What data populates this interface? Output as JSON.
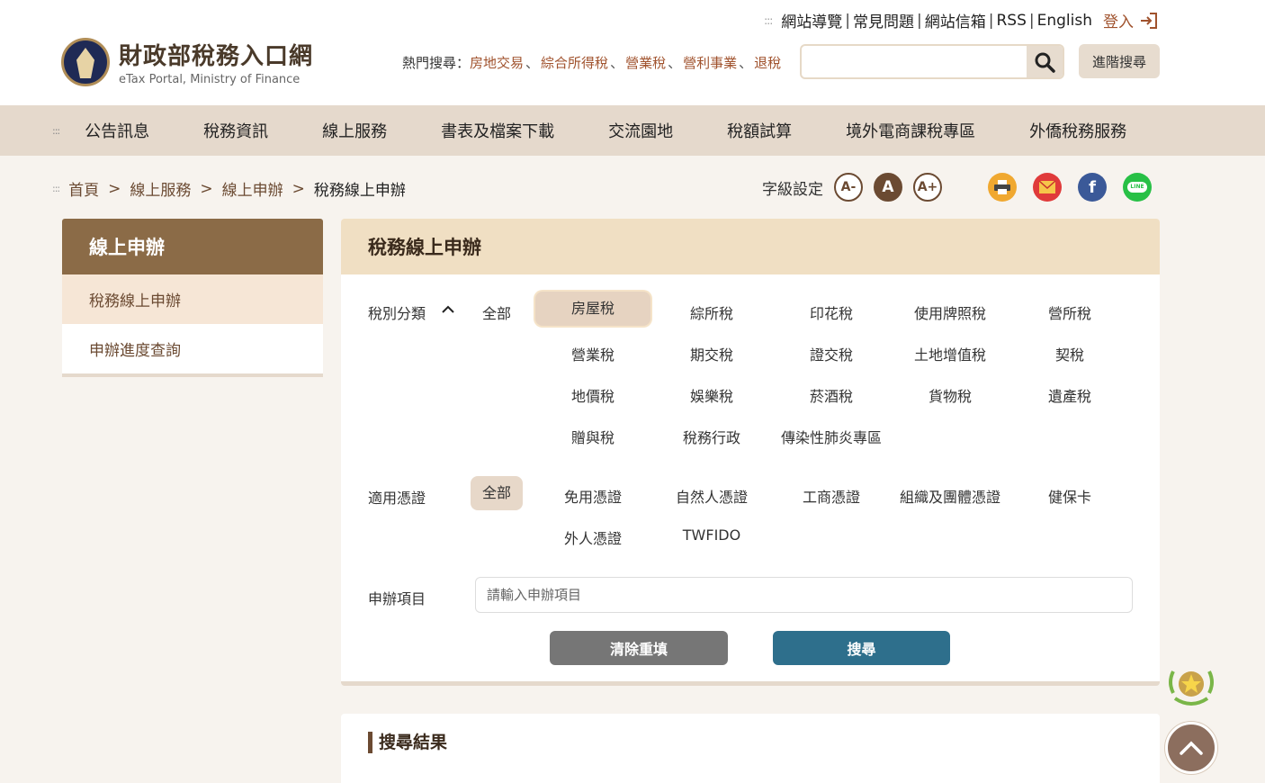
{
  "header": {
    "util_links": [
      "網站導覽",
      "常見問題",
      "網站信箱",
      "RSS",
      "English"
    ],
    "login_label": "登入",
    "logo_cn": "財政部稅務入口網",
    "logo_en": "eTax Portal, Ministry of Finance",
    "hot_label": "熱門搜尋：",
    "hot_keywords": [
      "房地交易",
      "綜合所得稅",
      "營業稅",
      "營利事業",
      "退稅"
    ],
    "search_placeholder": "",
    "advanced_search": "進階搜尋"
  },
  "mainnav": [
    "公告訊息",
    "稅務資訊",
    "線上服務",
    "書表及檔案下載",
    "交流園地",
    "稅額試算",
    "境外電商課稅專區",
    "外僑稅務服務"
  ],
  "breadcrumb": {
    "items": [
      "首頁",
      "線上服務",
      "線上申辦"
    ],
    "current": "稅務線上申辦"
  },
  "font_setting": {
    "label": "字級設定",
    "small": "A-",
    "medium": "A",
    "large": "A+"
  },
  "share": {
    "print_icon": "print-icon",
    "mail_icon": "mail-icon",
    "facebook_icon": "facebook-icon",
    "line_icon": "line-icon",
    "facebook_text": "f",
    "line_text": "LINE",
    "colors": {
      "print": "#f0a830",
      "mail": "#e03a3a",
      "facebook": "#3b5998",
      "line": "#28c046"
    }
  },
  "sidebar": {
    "title": "線上申辦",
    "items": [
      {
        "label": "稅務線上申辦",
        "active": true
      },
      {
        "label": "申辦進度查詢",
        "active": false
      }
    ]
  },
  "panel": {
    "title": "稅務線上申辦",
    "tax_category_label": "稅別分類",
    "tax_all": "全部",
    "tax_options": [
      "房屋稅",
      "綜所稅",
      "印花稅",
      "使用牌照稅",
      "營所稅",
      "營業稅",
      "期交稅",
      "證交稅",
      "土地增值稅",
      "契稅",
      "地價稅",
      "娛樂稅",
      "菸酒稅",
      "貨物稅",
      "遺產稅",
      "贈與稅",
      "稅務行政",
      "傳染性肺炎專區"
    ],
    "tax_selected": "房屋稅",
    "cert_label": "適用憑證",
    "cert_all": "全部",
    "cert_options": [
      "免用憑證",
      "自然人憑證",
      "工商憑證",
      "組織及團體憑證",
      "健保卡",
      "外人憑證",
      "TWFIDO"
    ],
    "cert_selected": "全部",
    "apply_label": "申辦項目",
    "apply_placeholder": "請輸入申辦項目",
    "clear_button": "清除重填",
    "search_button": "搜尋"
  },
  "results": {
    "title": "搜尋結果"
  },
  "colors": {
    "brown": "#6b4a32",
    "nav_bg": "#e5d9cc",
    "search_btn": "#2e6f8c",
    "clear_btn": "#767676"
  }
}
